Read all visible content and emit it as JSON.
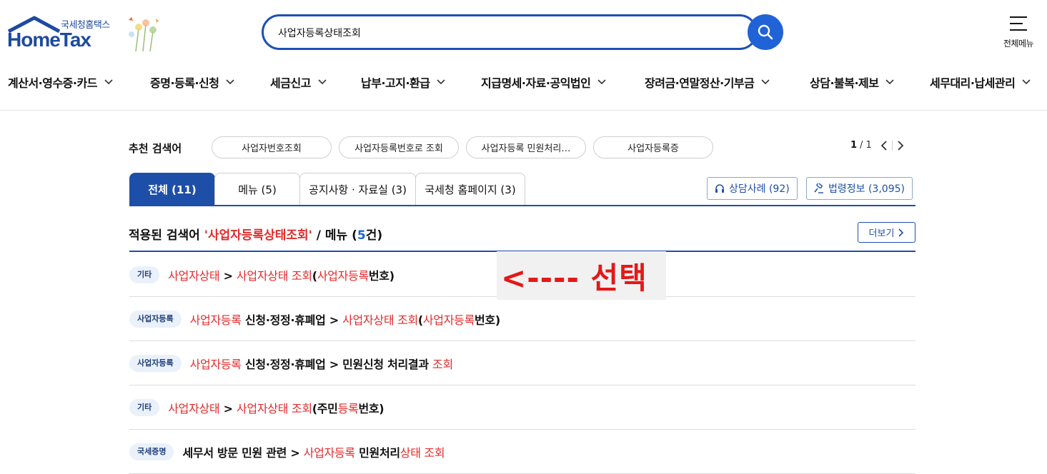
{
  "header": {
    "logo_ko": "국세청홈택스",
    "logo_en": "HomeTax",
    "search_value": "사업자등록상태조회",
    "all_menu_label": "전체메뉴"
  },
  "gnb": [
    "계산서·영수증·카드",
    "증명·등록·신청",
    "세금신고",
    "납부·고지·환급",
    "지급명세·자료·공익법인",
    "장려금·연말정산·기부금",
    "상담·불복·제보",
    "세무대리·납세관리"
  ],
  "recommended": {
    "label": "추천 검색어",
    "chips": [
      "사업자번호조회",
      "사업자등록번호로 조회",
      "사업자등록 민원처리…",
      "사업자등록증"
    ],
    "page_current": "1",
    "page_total": "/ 1"
  },
  "tabs": [
    "전체 (11)",
    "메뉴 (5)",
    "공지사항 · 자료실 (3)",
    "국세청 홈페이지 (3)"
  ],
  "side_buttons": [
    "상담사례 (92)",
    "법령정보 (3,095)"
  ],
  "result": {
    "prefix": "적용된 검색어 ",
    "query": "'사업자등록상태조회'",
    "mid": " / 메뉴 (",
    "count": "5",
    "suffix": "건)",
    "more_label": "더보기"
  },
  "rows": [
    {
      "badge": "기타",
      "parts": [
        [
          "r",
          "사업자상태"
        ],
        [
          "b",
          " > "
        ],
        [
          "r",
          "사업자상태 조회"
        ],
        [
          "b",
          "("
        ],
        [
          "r",
          "사업자등록"
        ],
        [
          "b",
          "번호)"
        ]
      ]
    },
    {
      "badge": "사업자등록",
      "parts": [
        [
          "r",
          "사업자등록"
        ],
        [
          "b",
          " 신청·정정·휴폐업 > "
        ],
        [
          "r",
          "사업자상태 조회"
        ],
        [
          "b",
          "("
        ],
        [
          "r",
          "사업자등록"
        ],
        [
          "b",
          "번호)"
        ]
      ]
    },
    {
      "badge": "사업자등록",
      "parts": [
        [
          "r",
          "사업자등록"
        ],
        [
          "b",
          " 신청·정정·휴폐업 > 민원신청 처리결과 "
        ],
        [
          "r",
          "조회"
        ]
      ]
    },
    {
      "badge": "기타",
      "parts": [
        [
          "r",
          "사업자상태"
        ],
        [
          "b",
          " > "
        ],
        [
          "r",
          "사업자상태 조회"
        ],
        [
          "b",
          "(주민"
        ],
        [
          "r",
          "등록"
        ],
        [
          "b",
          "번호)"
        ]
      ]
    },
    {
      "badge": "국세증명",
      "parts": [
        [
          "b",
          "세무서 방문 민원 관련 > "
        ],
        [
          "r",
          "사업자등록"
        ],
        [
          "b",
          " 민원처리"
        ],
        [
          "r",
          "상태 조회"
        ]
      ]
    }
  ],
  "annotation": "<---- 선택",
  "colors": {
    "brand": "#1e4fa8",
    "highlight": "#e32b2b",
    "search_button": "#1f63d6"
  }
}
